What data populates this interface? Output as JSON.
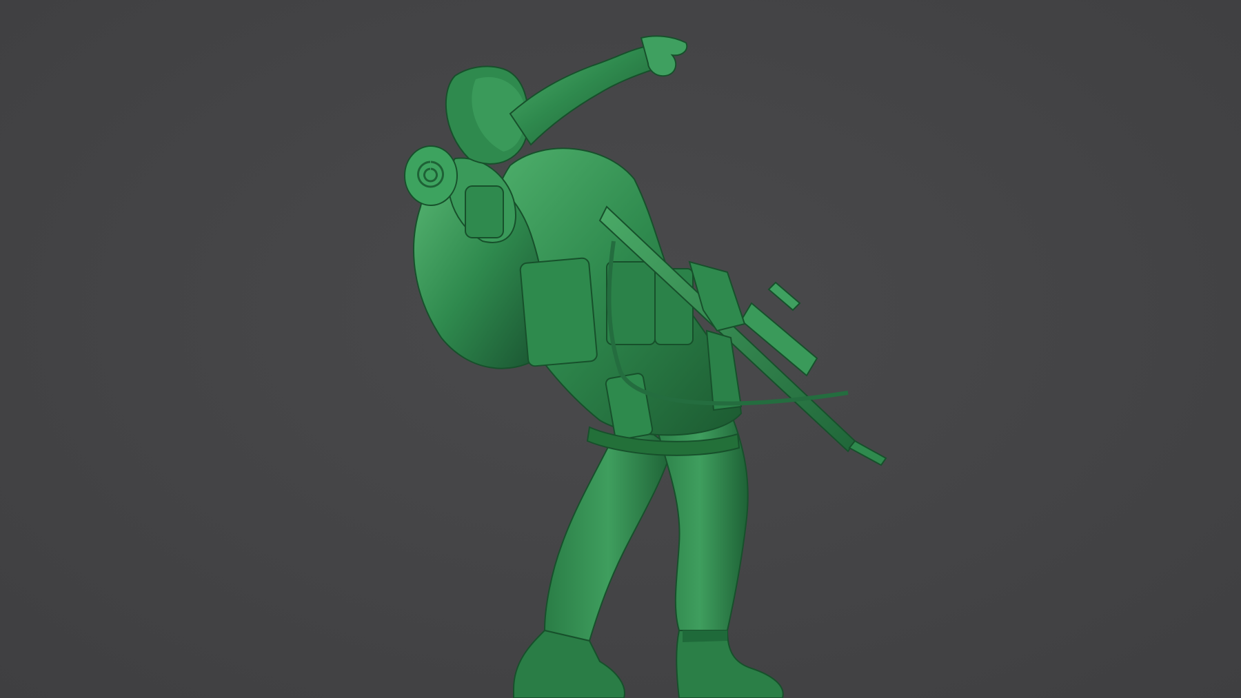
{
  "scene": {
    "subject": "green-toy-soldier-sculpt",
    "colors": {
      "background": "#444446",
      "model_base": "#2f8a4e",
      "model_light": "#4fb06c",
      "model_shadow": "#1c5a31",
      "model_deep": "#134226"
    }
  }
}
